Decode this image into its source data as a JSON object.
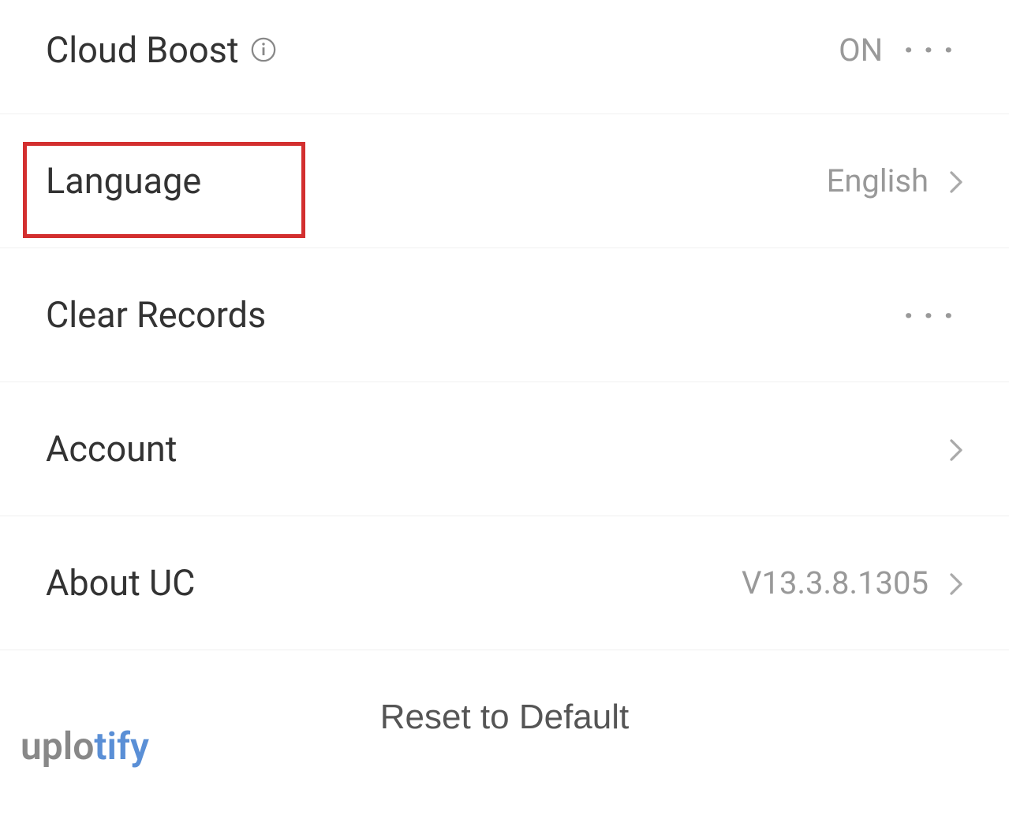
{
  "settings": {
    "cloudBoost": {
      "label": "Cloud Boost",
      "value": "ON"
    },
    "language": {
      "label": "Language",
      "value": "English"
    },
    "clearRecords": {
      "label": "Clear Records"
    },
    "account": {
      "label": "Account"
    },
    "aboutUc": {
      "label": "About UC",
      "value": "V13.3.8.1305"
    }
  },
  "resetButton": {
    "label": "Reset to Default"
  },
  "watermark": {
    "part1": "uplo",
    "part2": "tify"
  }
}
